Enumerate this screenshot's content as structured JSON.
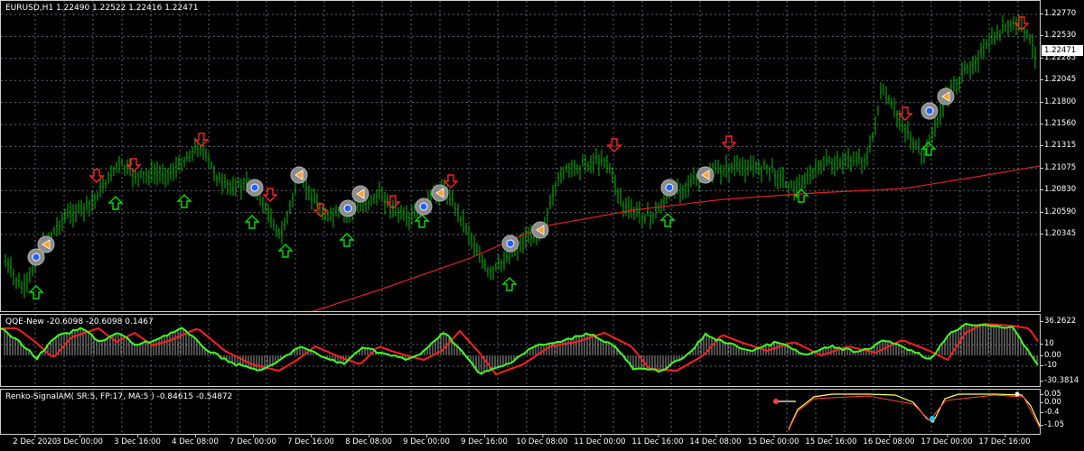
{
  "main_chart": {
    "title": "EURUSD,H1  1.22490 1.22522 1.22416 1.22471",
    "price_labels": [
      "1.22770",
      "1.22530",
      "1.22285",
      "1.22045",
      "1.21800",
      "1.21560",
      "1.21315",
      "1.21075",
      "1.20830",
      "1.20590",
      "1.20345"
    ],
    "current_price": "1.22471",
    "colors": {
      "candles": "#00c000",
      "ma": "#e02020",
      "grid": "#5a6470",
      "arrow_up": "#00e000",
      "arrow_down": "#ff2020"
    }
  },
  "qqe_indicator": {
    "title": "QQE-New -20.6098 -20.6098 0.1467",
    "levels": [
      "36.2622",
      "10",
      "0.00",
      "-10",
      "-30.3814"
    ],
    "colors": {
      "fast": "#40ff20",
      "slow": "#ff2020",
      "histogram": "#c0c0c0"
    }
  },
  "renko_indicator": {
    "title": "Renko-SignalAM( SR:5, FP:17, MA:5 ) -0.84615 -0.54872",
    "levels": [
      "0.05",
      "0.00",
      "-0.4",
      "-1.05"
    ],
    "colors": {
      "line": "#ffff60",
      "signal": "#ff4040",
      "marker_up": "#20c0ff",
      "marker_down": "#ffffff"
    }
  },
  "time_axis": {
    "labels": [
      "2 Dec 2020",
      "3 Dec 00:00",
      "3 Dec 16:00",
      "4 Dec 08:00",
      "7 Dec 00:00",
      "7 Dec 16:00",
      "8 Dec 08:00",
      "9 Dec 00:00",
      "9 Dec 16:00",
      "10 Dec 08:00",
      "11 Dec 00:00",
      "11 Dec 16:00",
      "14 Dec 08:00",
      "15 Dec 00:00",
      "15 Dec 16:00",
      "16 Dec 08:00",
      "17 Dec 00:00",
      "17 Dec 16:00"
    ]
  }
}
